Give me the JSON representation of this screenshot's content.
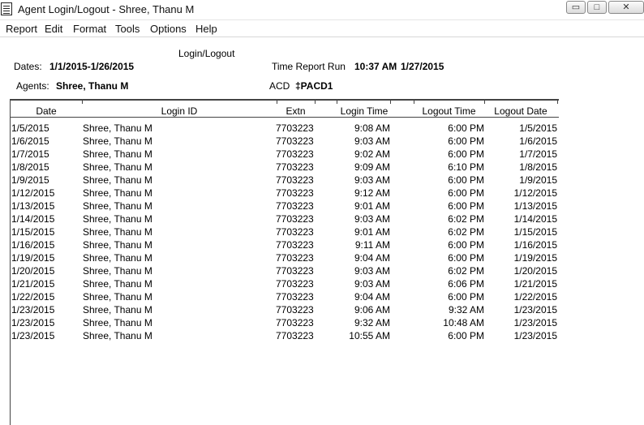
{
  "window": {
    "title": "Agent Login/Logout - Shree, Thanu M",
    "min_glyph": "▭",
    "max_glyph": "□",
    "close_glyph": "✕"
  },
  "menu": [
    "Report",
    "Edit",
    "Format",
    "Tools",
    "Options",
    "Help"
  ],
  "report": {
    "title": "Login/Logout",
    "dates_label": "Dates:",
    "dates_value": "1/1/2015-1/26/2015",
    "run_label": "Time Report Run",
    "run_time": "10:37 AM",
    "run_date": "1/27/2015",
    "agents_label": "Agents:",
    "agents_value": "Shree, Thanu M",
    "acd_label": "ACD",
    "acd_value": "‡PACD1"
  },
  "table": {
    "columns": [
      "Date",
      "Login ID",
      "Extn",
      "Login Time",
      "Logout Time",
      "Logout Date"
    ],
    "rows": [
      [
        "1/5/2015",
        "Shree, Thanu M",
        "7703223",
        "9:08 AM",
        "6:00 PM",
        "1/5/2015"
      ],
      [
        "1/6/2015",
        "Shree, Thanu M",
        "7703223",
        "9:03 AM",
        "6:00 PM",
        "1/6/2015"
      ],
      [
        "1/7/2015",
        "Shree, Thanu M",
        "7703223",
        "9:02 AM",
        "6:00 PM",
        "1/7/2015"
      ],
      [
        "1/8/2015",
        "Shree, Thanu M",
        "7703223",
        "9:09 AM",
        "6:10 PM",
        "1/8/2015"
      ],
      [
        "1/9/2015",
        "Shree, Thanu M",
        "7703223",
        "9:03 AM",
        "6:00 PM",
        "1/9/2015"
      ],
      [
        "1/12/2015",
        "Shree, Thanu M",
        "7703223",
        "9:12 AM",
        "6:00 PM",
        "1/12/2015"
      ],
      [
        "1/13/2015",
        "Shree, Thanu M",
        "7703223",
        "9:01 AM",
        "6:00 PM",
        "1/13/2015"
      ],
      [
        "1/14/2015",
        "Shree, Thanu M",
        "7703223",
        "9:03 AM",
        "6:02 PM",
        "1/14/2015"
      ],
      [
        "1/15/2015",
        "Shree, Thanu M",
        "7703223",
        "9:01 AM",
        "6:02 PM",
        "1/15/2015"
      ],
      [
        "1/16/2015",
        "Shree, Thanu M",
        "7703223",
        "9:11 AM",
        "6:00 PM",
        "1/16/2015"
      ],
      [
        "1/19/2015",
        "Shree, Thanu M",
        "7703223",
        "9:04 AM",
        "6:00 PM",
        "1/19/2015"
      ],
      [
        "1/20/2015",
        "Shree, Thanu M",
        "7703223",
        "9:03 AM",
        "6:02 PM",
        "1/20/2015"
      ],
      [
        "1/21/2015",
        "Shree, Thanu M",
        "7703223",
        "9:03 AM",
        "6:06 PM",
        "1/21/2015"
      ],
      [
        "1/22/2015",
        "Shree, Thanu M",
        "7703223",
        "9:04 AM",
        "6:00 PM",
        "1/22/2015"
      ],
      [
        "1/23/2015",
        "Shree, Thanu M",
        "7703223",
        "9:06 AM",
        "9:32 AM",
        "1/23/2015"
      ],
      [
        "1/23/2015",
        "Shree, Thanu M",
        "7703223",
        "9:32 AM",
        "10:48 AM",
        "1/23/2015"
      ],
      [
        "1/23/2015",
        "Shree, Thanu M",
        "7703223",
        "10:55 AM",
        "6:00 PM",
        "1/23/2015"
      ]
    ]
  }
}
